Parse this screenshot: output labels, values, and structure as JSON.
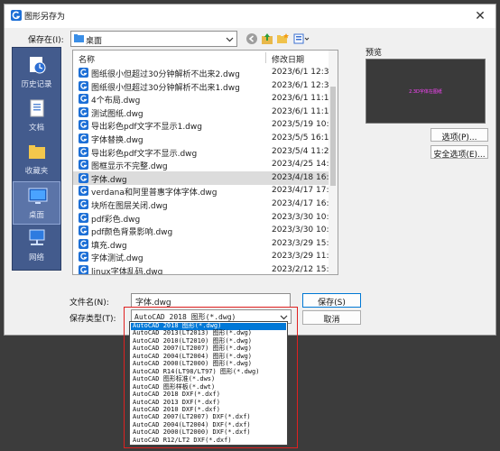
{
  "window": {
    "title": "图形另存为",
    "close_glyph": "✕"
  },
  "save_in": {
    "label": "保存在(I):",
    "value": "桌面"
  },
  "places": [
    {
      "label": "历史记录",
      "icon": "history-icon",
      "selected": false
    },
    {
      "label": "文档",
      "icon": "documents-icon",
      "selected": false
    },
    {
      "label": "收藏夹",
      "icon": "favorites-folder-icon",
      "selected": false
    },
    {
      "label": "桌面",
      "icon": "desktop-icon",
      "selected": true
    },
    {
      "label": "网络",
      "icon": "network-icon",
      "selected": false
    }
  ],
  "file_list": {
    "headers": {
      "name": "名称",
      "date": "修改日期"
    },
    "rows": [
      {
        "name": "图纸很小但超过30分钟解析不出来2.dwg",
        "date": "2023/6/1 12:39",
        "selected": false
      },
      {
        "name": "图纸很小但超过30分钟解析不出来1.dwg",
        "date": "2023/6/1 12:36",
        "selected": false
      },
      {
        "name": "4个布局.dwg",
        "date": "2023/6/1 11:14",
        "selected": false
      },
      {
        "name": "测试图纸.dwg",
        "date": "2023/6/1 11:12",
        "selected": false
      },
      {
        "name": "导出彩色pdf文字不显示1.dwg",
        "date": "2023/5/19 10:43",
        "selected": false
      },
      {
        "name": "字体替换.dwg",
        "date": "2023/5/5 16:15",
        "selected": false
      },
      {
        "name": "导出彩色pdf文字不显示.dwg",
        "date": "2023/5/4 11:25",
        "selected": false
      },
      {
        "name": "图框显示不完整.dwg",
        "date": "2023/4/25 14:21",
        "selected": false
      },
      {
        "name": "字体.dwg",
        "date": "2023/4/18 16:52",
        "selected": true
      },
      {
        "name": "verdana和阿里普惠字体字体.dwg",
        "date": "2023/4/17 17:00",
        "selected": false
      },
      {
        "name": "块所在图层关闭.dwg",
        "date": "2023/4/17 16:33",
        "selected": false
      },
      {
        "name": "pdf彩色.dwg",
        "date": "2023/3/30 10:55",
        "selected": false
      },
      {
        "name": "pdf颜色背景影响.dwg",
        "date": "2023/3/30 10:19",
        "selected": false
      },
      {
        "name": "填充.dwg",
        "date": "2023/3/29 15:21",
        "selected": false
      },
      {
        "name": "字体测试.dwg",
        "date": "2023/3/29 11:45",
        "selected": false
      },
      {
        "name": "linux字体乱码.dwg",
        "date": "2023/2/12 15:30",
        "selected": false
      }
    ]
  },
  "preview": {
    "label": "预览",
    "caption": "2.3D字体在图纸"
  },
  "buttons": {
    "options": "选项(P)...",
    "security": "安全选项(E)...",
    "save": "保存(S)",
    "cancel": "取消"
  },
  "file_name": {
    "label": "文件名(N):",
    "value": "字体.dwg"
  },
  "file_type": {
    "label": "保存类型(T):",
    "value": "AutoCAD 2018 图形(*.dwg)",
    "options": [
      "AutoCAD 2018 图形(*.dwg)",
      "AutoCAD 2013(LT2013) 图形(*.dwg)",
      "AutoCAD 2010(LT2010) 图形(*.dwg)",
      "AutoCAD 2007(LT2007) 图形(*.dwg)",
      "AutoCAD 2004(LT2004) 图形(*.dwg)",
      "AutoCAD 2000(LT2000) 图形(*.dwg)",
      "AutoCAD R14(LT98/LT97) 图形(*.dwg)",
      "AutoCAD 图形标准(*.dws)",
      "AutoCAD 图形样板(*.dwt)",
      "AutoCAD 2018 DXF(*.dxf)",
      "AutoCAD 2013 DXF(*.dxf)",
      "AutoCAD 2010 DXF(*.dxf)",
      "AutoCAD 2007(LT2007) DXF(*.dxf)",
      "AutoCAD 2004(LT2004) DXF(*.dxf)",
      "AutoCAD 2000(LT2000) DXF(*.dxf)",
      "AutoCAD R12/LT2 DXF(*.dxf)"
    ],
    "selected_index": 0
  },
  "colors": {
    "places_bg": "#435b8d",
    "selection": "#0078d7",
    "highlight_box": "#e02020"
  }
}
